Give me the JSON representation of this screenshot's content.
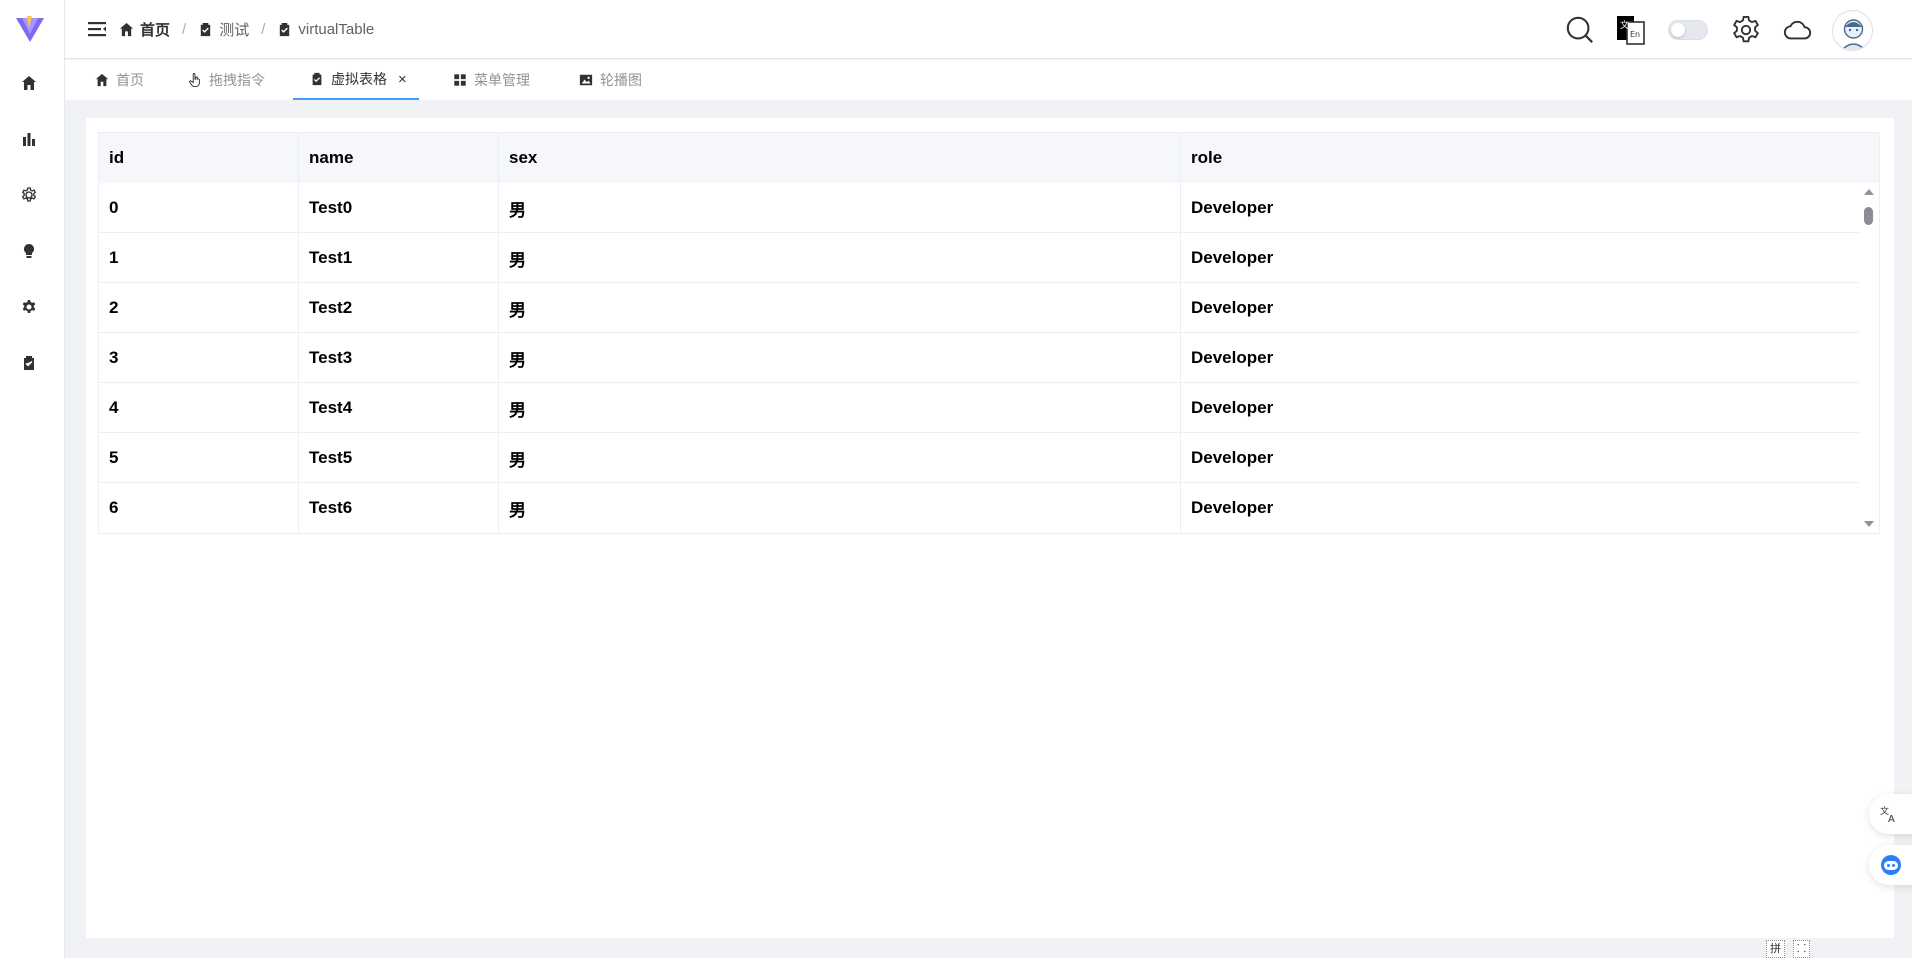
{
  "breadcrumb": {
    "items": [
      {
        "label": "首页"
      },
      {
        "label": "测试"
      },
      {
        "label": "virtualTable"
      }
    ],
    "separator": "/"
  },
  "header": {
    "icons": [
      "search-icon",
      "language-switch-icon",
      "dark-mode-switch",
      "settings-gear-icon",
      "cloud-icon",
      "user-avatar"
    ]
  },
  "tags": [
    {
      "label": "首页",
      "icon": "home-icon",
      "active": false
    },
    {
      "label": "拖拽指令",
      "icon": "pointer-hand-icon",
      "active": false
    },
    {
      "label": "虚拟表格",
      "icon": "clipboard-check-icon",
      "active": true,
      "close": "×"
    },
    {
      "label": "菜单管理",
      "icon": "grid-icon",
      "active": false
    },
    {
      "label": "轮播图",
      "icon": "image-icon",
      "active": false
    }
  ],
  "table": {
    "columns": [
      "id",
      "name",
      "sex",
      "role"
    ],
    "rows": [
      [
        "0",
        "Test0",
        "男",
        "Developer"
      ],
      [
        "1",
        "Test1",
        "男",
        "Developer"
      ],
      [
        "2",
        "Test2",
        "男",
        "Developer"
      ],
      [
        "3",
        "Test3",
        "男",
        "Developer"
      ],
      [
        "4",
        "Test4",
        "男",
        "Developer"
      ],
      [
        "5",
        "Test5",
        "男",
        "Developer"
      ],
      [
        "6",
        "Test6",
        "男",
        "Developer"
      ]
    ]
  },
  "ime": {
    "mode": "拼",
    "width": "⸬"
  },
  "colors": {
    "accent": "#409eff",
    "logo_purple": "#7c6cf0",
    "logo_yellow": "#f7c948"
  }
}
